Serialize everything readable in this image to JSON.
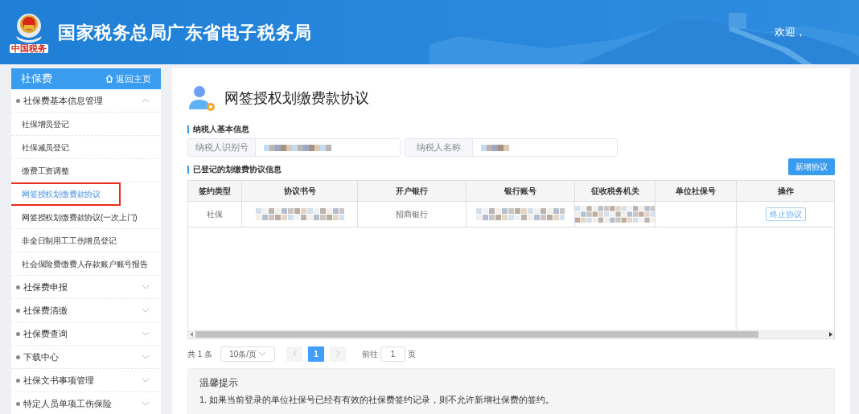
{
  "header": {
    "logo_caption": "中国税务",
    "title": "国家税务总局广东省电子税务局",
    "welcome": "欢迎，"
  },
  "sidebar": {
    "title": "社保费",
    "home_link": "返回主页",
    "groups": [
      {
        "label": "社保费基本信息管理",
        "expanded": true,
        "children": [
          {
            "label": "社保增员登记",
            "selected": false
          },
          {
            "label": "社保减员登记",
            "selected": false
          },
          {
            "label": "缴费工资调整",
            "selected": false
          },
          {
            "label": "网签授权划缴费款协议",
            "selected": true
          },
          {
            "label": "网签授权划缴费款协议(一次上门)",
            "selected": false
          },
          {
            "label": "非全日制用工工伤增员登记",
            "selected": false
          },
          {
            "label": "社会保险费缴费人存款账户账号报告",
            "selected": false
          }
        ]
      },
      {
        "label": "社保费申报",
        "expanded": false
      },
      {
        "label": "社保费清缴",
        "expanded": false
      },
      {
        "label": "社保费查询",
        "expanded": false
      },
      {
        "label": "下载中心",
        "expanded": false
      },
      {
        "label": "社保文书事项管理",
        "expanded": false
      },
      {
        "label": "特定人员单项工伤保险",
        "expanded": false
      }
    ]
  },
  "main": {
    "title": "网签授权划缴费款协议",
    "taxpayer": {
      "heading": "纳税人基本信息",
      "fields": [
        {
          "label": "纳税人识别号"
        },
        {
          "label": "纳税人名称"
        }
      ]
    },
    "agreements": {
      "heading": "已登记的划缴费协议信息",
      "add_button": "新增协议",
      "columns": [
        "签约类型",
        "协议书号",
        "开户银行",
        "银行账号",
        "征收税务机关",
        "单位社保号",
        "操作"
      ],
      "rows": [
        {
          "cells": [
            {
              "kind": "text",
              "text": "社保"
            },
            {
              "kind": "redacted"
            },
            {
              "kind": "text",
              "text": "招商银行"
            },
            {
              "kind": "redacted"
            },
            {
              "kind": "redacted"
            },
            {
              "kind": "empty"
            },
            {
              "kind": "button",
              "text": "终止协议"
            }
          ]
        }
      ]
    },
    "pagination": {
      "total": "共 1 条",
      "page_size": "10条/页",
      "pages": [
        {
          "label": "1",
          "selected": true
        }
      ],
      "goto_label": "前往",
      "goto_value": "1",
      "page_suffix": "页"
    },
    "tips": {
      "title": "温馨提示",
      "items": [
        "1. 如果当前登录的单位社保号已经有有效的社保费签约记录，则不允许新增社保费的签约。"
      ]
    }
  }
}
